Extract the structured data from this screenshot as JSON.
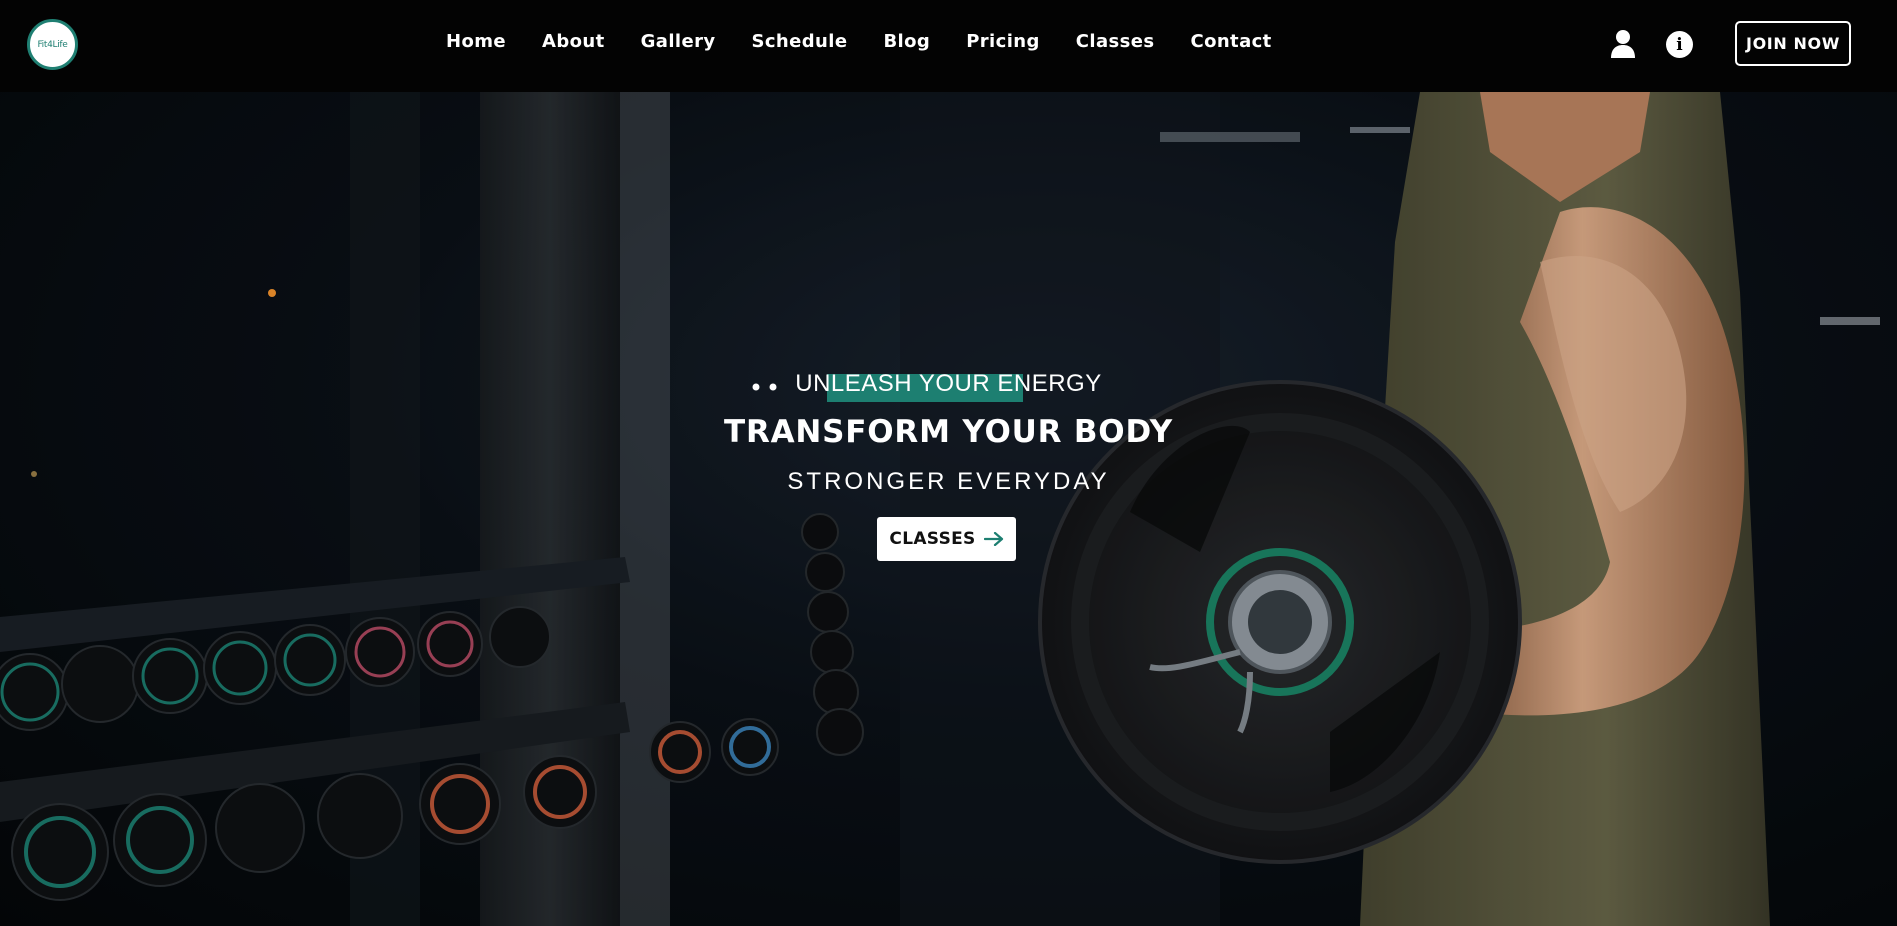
{
  "brand": {
    "logo_text": "Fit4Life",
    "accent_color": "#1d7f71"
  },
  "nav": {
    "links": [
      "Home",
      "About",
      "Gallery",
      "Schedule",
      "Blog",
      "Pricing",
      "Classes",
      "Contact"
    ],
    "join_label": "JOIN NOW",
    "icons": [
      "user-icon",
      "info-icon"
    ]
  },
  "hero": {
    "tagline": "UNLEASH YOUR ENERGY",
    "title": "TRANSFORM YOUR BODY",
    "subtitle": "STRONGER EVERYDAY",
    "cta_label": "CLASSES",
    "cta_icon": "arrow-right-icon"
  }
}
